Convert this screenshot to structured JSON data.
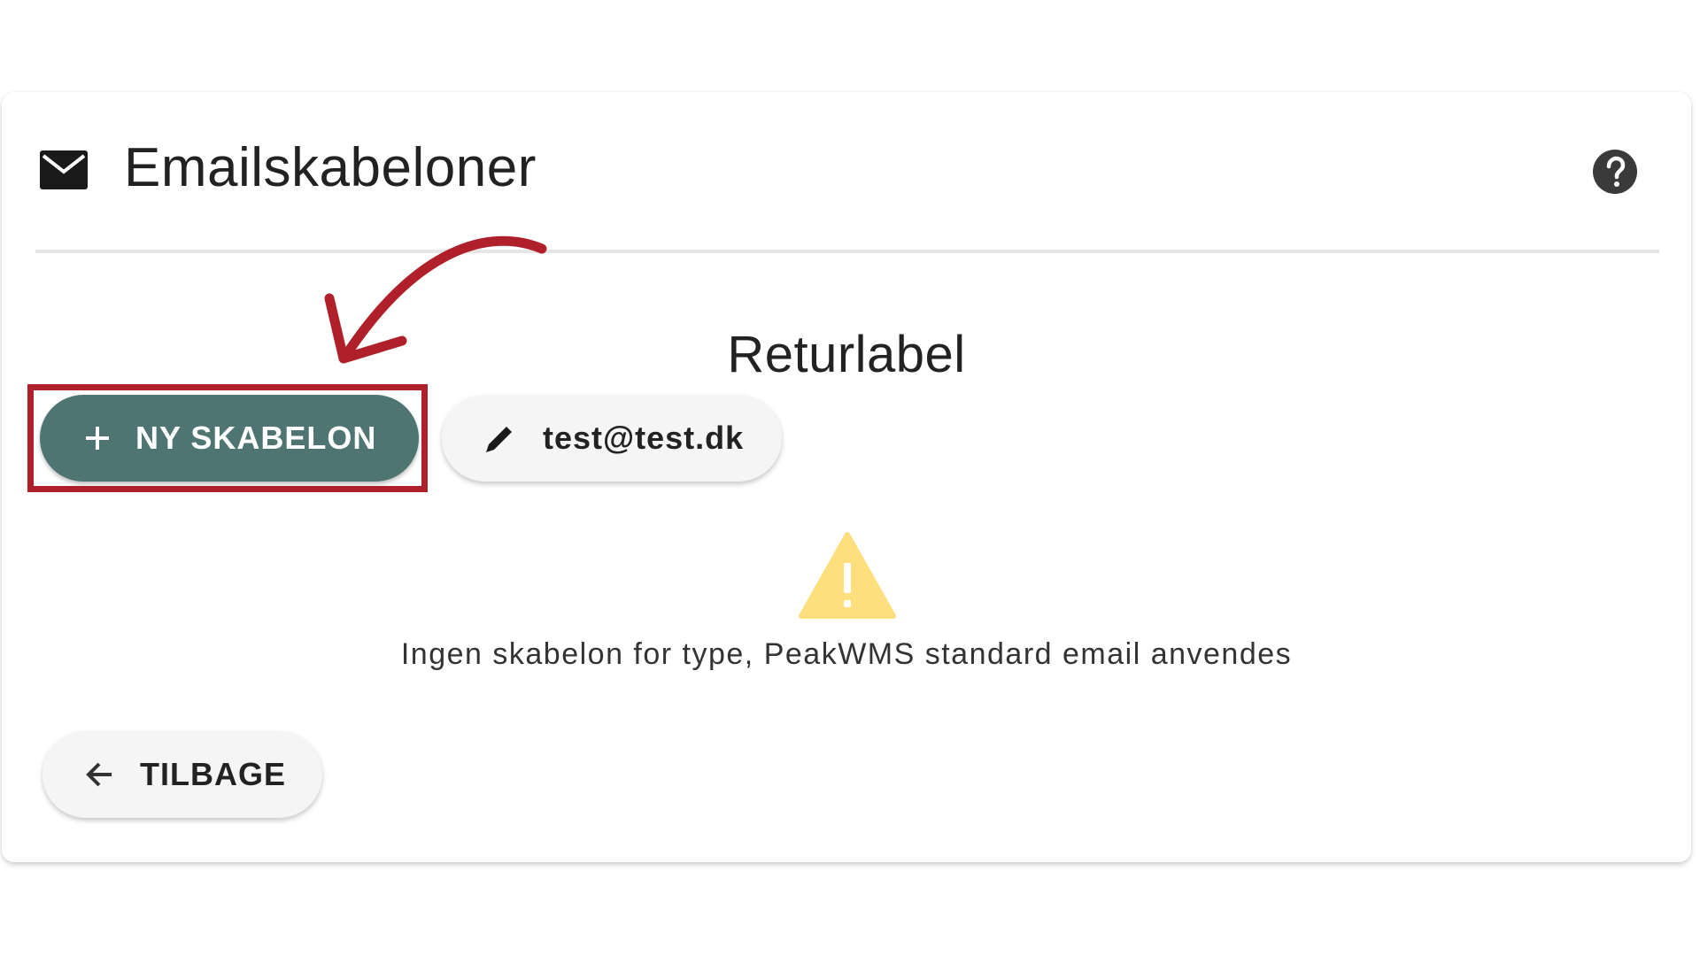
{
  "header": {
    "icon": "mail-icon",
    "title": "Emailskabeloner",
    "help_icon": "help-icon"
  },
  "section": {
    "title": "Returlabel"
  },
  "actions": {
    "new_template": {
      "icon": "plus-icon",
      "label": "NY SKABELON",
      "color": "#4f7573"
    },
    "edit_template": {
      "icon": "pencil-icon",
      "label": "test@test.dk"
    }
  },
  "notice": {
    "icon": "warning-icon",
    "icon_color": "#fddf7e",
    "text": "Ingen skabelon for type, PeakWMS standard email anvendes"
  },
  "footer": {
    "back": {
      "icon": "arrow-left-icon",
      "label": "TILBAGE"
    }
  },
  "annotation": {
    "highlight_color": "#b0202a",
    "arrow_icon": "curved-arrow-icon"
  }
}
